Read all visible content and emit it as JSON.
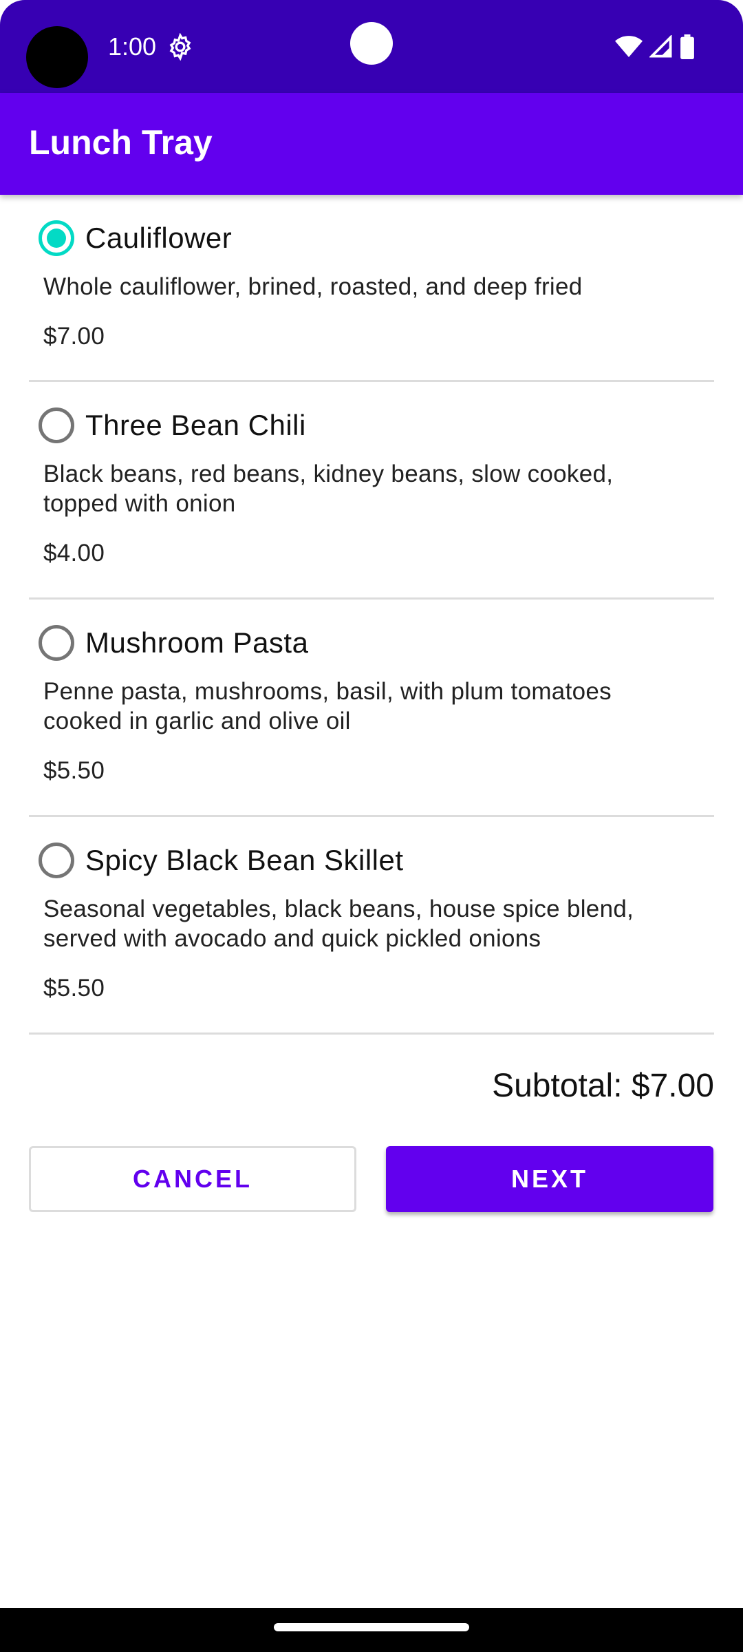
{
  "status_bar": {
    "time": "1:00",
    "icons": [
      "settings-gear-icon",
      "wifi-icon",
      "signal-icon",
      "battery-icon"
    ]
  },
  "app_bar": {
    "title": "Lunch Tray"
  },
  "menu": {
    "items": [
      {
        "name": "Cauliflower",
        "description": "Whole cauliflower, brined, roasted, and deep fried",
        "price": "$7.00",
        "selected": true
      },
      {
        "name": "Three Bean Chili",
        "description": "Black beans, red beans, kidney beans, slow cooked, topped with onion",
        "price": "$4.00",
        "selected": false
      },
      {
        "name": "Mushroom Pasta",
        "description": "Penne pasta, mushrooms, basil, with plum tomatoes cooked in garlic and olive oil",
        "price": "$5.50",
        "selected": false
      },
      {
        "name": "Spicy Black Bean Skillet",
        "description": "Seasonal vegetables, black beans, house spice blend, served with avocado and quick pickled onions",
        "price": "$5.50",
        "selected": false
      }
    ]
  },
  "summary": {
    "subtotal": "Subtotal: $7.00"
  },
  "actions": {
    "cancel_label": "CANCEL",
    "next_label": "NEXT"
  },
  "colors": {
    "status_bar": "#3700b3",
    "primary": "#6200ee",
    "radio_selected": "#03dac5",
    "radio_unselected": "#757575"
  }
}
